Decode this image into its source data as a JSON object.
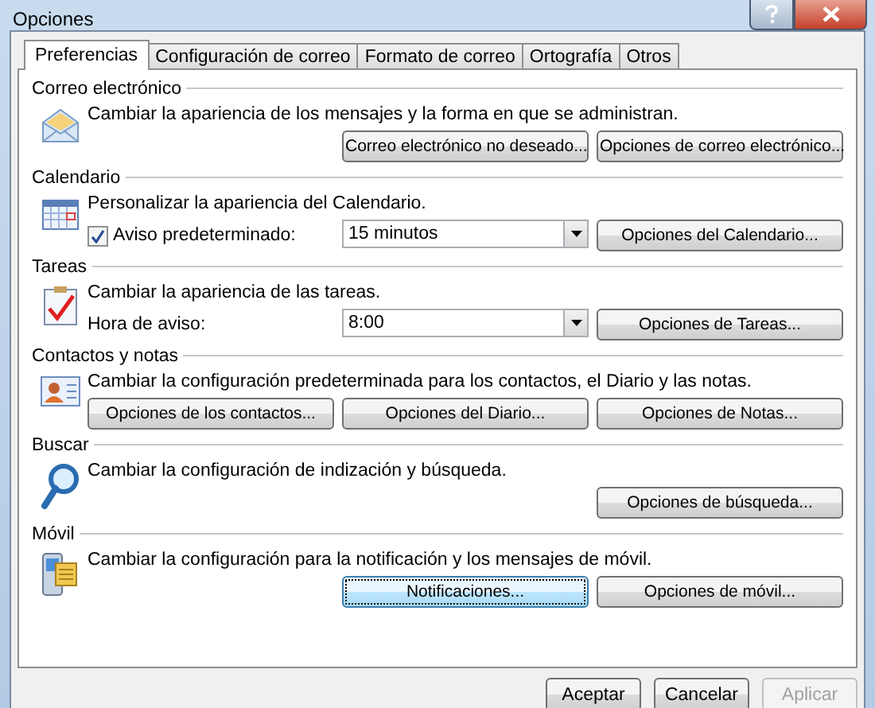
{
  "window": {
    "title": "Opciones"
  },
  "tabs": [
    {
      "label": "Preferencias",
      "selected": true
    },
    {
      "label": "Configuración de correo",
      "selected": false
    },
    {
      "label": "Formato de correo",
      "selected": false
    },
    {
      "label": "Ortografía",
      "selected": false
    },
    {
      "label": "Otros",
      "selected": false
    }
  ],
  "sections": [
    {
      "title": "Correo electrónico",
      "kind": "mail",
      "description": "Cambiar la apariencia de los mensajes y la forma en que se administran.",
      "controls": [
        {
          "kind": "button",
          "label": "Correo electrónico no deseado...",
          "focused": false
        },
        {
          "kind": "button",
          "label": "Opciones de correo electrónico...",
          "focused": false
        }
      ]
    },
    {
      "title": "Calendario",
      "kind": "calendar",
      "description": "Personalizar la apariencia del Calendario.",
      "controls": [
        {
          "kind": "checkbox",
          "label": "Aviso predeterminado:",
          "checked": true
        },
        {
          "kind": "dropdown",
          "value": "15 minutos"
        },
        {
          "kind": "button",
          "label": "Opciones del Calendario...",
          "focused": false
        }
      ]
    },
    {
      "title": "Tareas",
      "kind": "tasks",
      "description": "Cambiar la apariencia de las tareas.",
      "controls": [
        {
          "kind": "label",
          "label": "Hora de aviso:"
        },
        {
          "kind": "dropdown",
          "value": "8:00"
        },
        {
          "kind": "button",
          "label": "Opciones de Tareas...",
          "focused": false
        }
      ]
    },
    {
      "title": "Contactos y notas",
      "kind": "contacts",
      "description": "Cambiar la configuración predeterminada para los contactos, el Diario y las notas.",
      "controls": [
        {
          "kind": "button",
          "label": "Opciones de los contactos...",
          "focused": false
        },
        {
          "kind": "button",
          "label": "Opciones del Diario...",
          "focused": false
        },
        {
          "kind": "button",
          "label": "Opciones de Notas...",
          "focused": false
        }
      ]
    },
    {
      "title": "Buscar",
      "kind": "search",
      "description": "Cambiar la configuración de indización y búsqueda.",
      "controls": [
        {
          "kind": "button",
          "label": "Opciones de búsqueda...",
          "focused": false
        }
      ]
    },
    {
      "title": "Móvil",
      "kind": "mobile",
      "description": "Cambiar la configuración para la notificación y los mensajes de móvil.",
      "controls": [
        {
          "kind": "button",
          "label": "Notificaciones...",
          "focused": true
        },
        {
          "kind": "button",
          "label": "Opciones de móvil...",
          "focused": false
        }
      ]
    }
  ],
  "buttons": [
    {
      "label": "Aceptar",
      "disabled": false
    },
    {
      "label": "Cancelar",
      "disabled": false
    },
    {
      "label": "Aplicar",
      "disabled": true
    }
  ]
}
